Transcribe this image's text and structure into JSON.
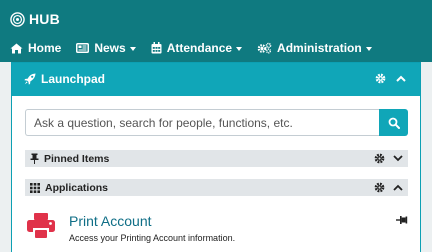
{
  "brand": {
    "name": "HUB"
  },
  "nav": {
    "home": "Home",
    "news": "News",
    "attendance": "Attendance",
    "administration": "Administration"
  },
  "panel": {
    "title": "Launchpad",
    "search_placeholder": "Ask a question, search for people, functions, etc."
  },
  "sections": {
    "pinned": "Pinned Items",
    "applications": "Applications"
  },
  "apps": [
    {
      "name": "Print Account",
      "description": "Access your Printing Account information."
    }
  ],
  "colors": {
    "topbar": "#0f7a80",
    "accent": "#10a6b8",
    "section_bg": "#e1e5e8",
    "print_icon": "#e0324a"
  }
}
